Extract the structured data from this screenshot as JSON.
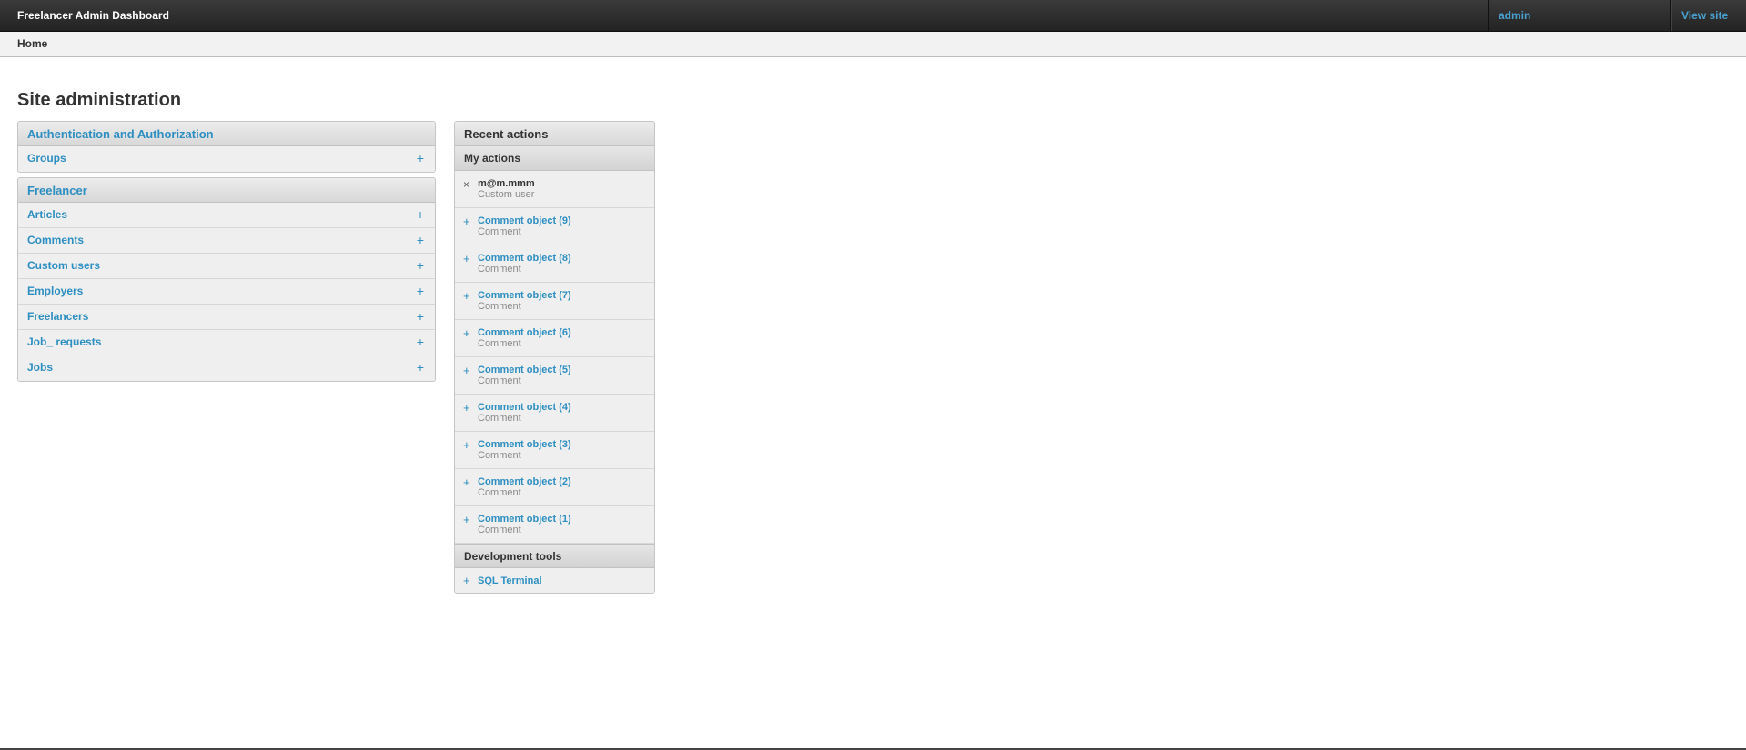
{
  "header": {
    "brand": "Freelancer Admin Dashboard",
    "user_link": "admin",
    "view_site": "View site"
  },
  "breadcrumb": {
    "home": "Home"
  },
  "page_title": "Site administration",
  "apps": [
    {
      "name": "Authentication and Authorization",
      "models": [
        {
          "label": "Groups",
          "add": "+"
        }
      ]
    },
    {
      "name": "Freelancer",
      "models": [
        {
          "label": "Articles",
          "add": "+"
        },
        {
          "label": "Comments",
          "add": "+"
        },
        {
          "label": "Custom users",
          "add": "+"
        },
        {
          "label": "Employers",
          "add": "+"
        },
        {
          "label": "Freelancers",
          "add": "+"
        },
        {
          "label": "Job_ requests",
          "add": "+"
        },
        {
          "label": "Jobs",
          "add": "+"
        }
      ]
    }
  ],
  "recent_actions": {
    "title": "Recent actions",
    "my_actions_title": "My actions",
    "items": [
      {
        "icon": "×",
        "object": "m@m.mmm",
        "type": "Custom user"
      },
      {
        "icon": "+",
        "object": "Comment object (9)",
        "type": "Comment"
      },
      {
        "icon": "+",
        "object": "Comment object (8)",
        "type": "Comment"
      },
      {
        "icon": "+",
        "object": "Comment object (7)",
        "type": "Comment"
      },
      {
        "icon": "+",
        "object": "Comment object (6)",
        "type": "Comment"
      },
      {
        "icon": "+",
        "object": "Comment object (5)",
        "type": "Comment"
      },
      {
        "icon": "+",
        "object": "Comment object (4)",
        "type": "Comment"
      },
      {
        "icon": "+",
        "object": "Comment object (3)",
        "type": "Comment"
      },
      {
        "icon": "+",
        "object": "Comment object (2)",
        "type": "Comment"
      },
      {
        "icon": "+",
        "object": "Comment object (1)",
        "type": "Comment"
      }
    ],
    "dev_tools_title": "Development tools",
    "dev_tools": [
      {
        "icon": "+",
        "label": "SQL Terminal"
      }
    ]
  },
  "colors": {
    "link": "#2d8fc1",
    "header_bg": "#2b2b2b",
    "header_link": "#49a1cf"
  }
}
